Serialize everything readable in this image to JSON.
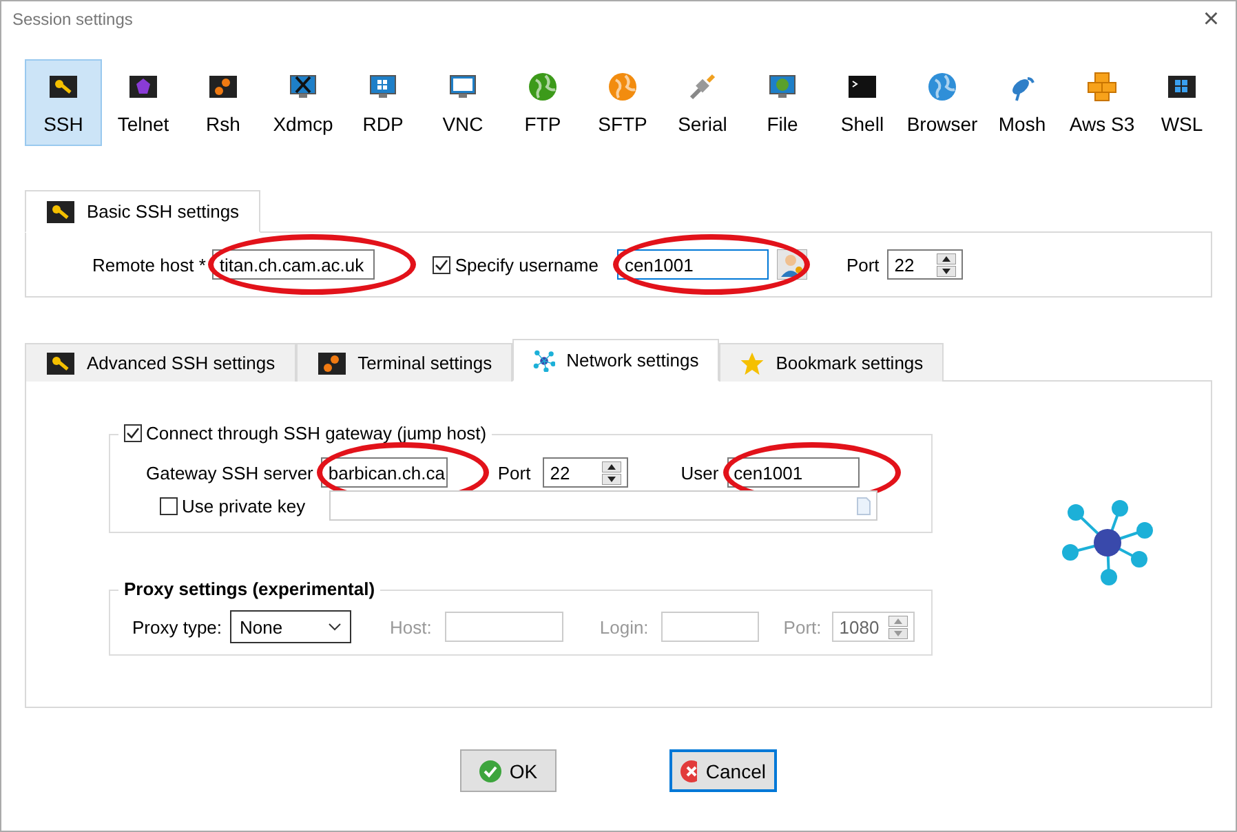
{
  "window": {
    "title": "Session settings",
    "close": "×"
  },
  "session_types": [
    {
      "label": "SSH",
      "selected": true
    },
    {
      "label": "Telnet",
      "selected": false
    },
    {
      "label": "Rsh",
      "selected": false
    },
    {
      "label": "Xdmcp",
      "selected": false
    },
    {
      "label": "RDP",
      "selected": false
    },
    {
      "label": "VNC",
      "selected": false
    },
    {
      "label": "FTP",
      "selected": false
    },
    {
      "label": "SFTP",
      "selected": false
    },
    {
      "label": "Serial",
      "selected": false
    },
    {
      "label": "File",
      "selected": false
    },
    {
      "label": "Shell",
      "selected": false
    },
    {
      "label": "Browser",
      "selected": false
    },
    {
      "label": "Mosh",
      "selected": false
    },
    {
      "label": "Aws S3",
      "selected": false
    },
    {
      "label": "WSL",
      "selected": false
    }
  ],
  "basic": {
    "tab": "Basic SSH settings",
    "remote_host": {
      "label": "Remote host *",
      "value": "titan.ch.cam.ac.uk",
      "circled": true
    },
    "specify_username": {
      "label": "Specify username",
      "checked": true
    },
    "username": {
      "value": "cen1001",
      "circled": true
    },
    "port": {
      "label": "Port",
      "value": "22"
    }
  },
  "tabs": [
    {
      "label": "Advanced SSH settings",
      "selected": false
    },
    {
      "label": "Terminal settings",
      "selected": false
    },
    {
      "label": "Network settings",
      "selected": true
    },
    {
      "label": "Bookmark settings",
      "selected": false
    }
  ],
  "gateway": {
    "label": "Connect through SSH gateway (jump host)",
    "checked": true,
    "server": {
      "label": "Gateway SSH server",
      "value": "barbican.ch.ca",
      "circled": true
    },
    "port": {
      "label": "Port",
      "value": "22"
    },
    "user": {
      "label": "User",
      "value": "cen1001",
      "circled": true
    },
    "private_key": {
      "label": "Use private key",
      "checked": false
    }
  },
  "proxy": {
    "title": "Proxy settings (experimental)",
    "type": {
      "label": "Proxy type:",
      "value": "None"
    },
    "host": {
      "label": "Host:",
      "disabled": true
    },
    "login": {
      "label": "Login:",
      "disabled": true
    },
    "port": {
      "label": "Port:",
      "value": "1080",
      "disabled": true
    }
  },
  "buttons": [
    {
      "label": "OK",
      "kind": "ok",
      "focused": false
    },
    {
      "label": "Cancel",
      "kind": "cancel",
      "focused": true
    }
  ]
}
